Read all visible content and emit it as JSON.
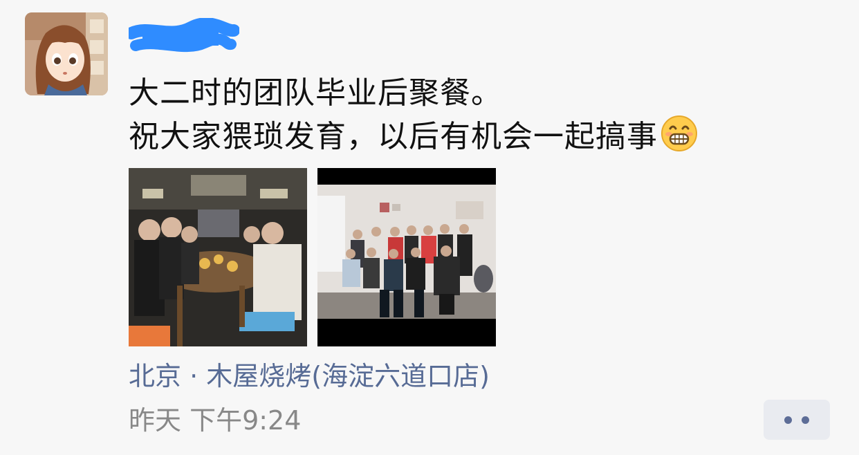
{
  "post": {
    "author_redacted": true,
    "text_lines": [
      "大二时的团队毕业后聚餐。",
      "祝大家猥琐发育，以后有机会一起搞事"
    ],
    "emoji": "grinning-face-emoji",
    "photos": [
      {
        "name": "restaurant-group-photo"
      },
      {
        "name": "office-group-photo"
      }
    ],
    "location": "北京 · 木屋烧烤(海淀六道口店)",
    "timestamp": "昨天 下午9:24"
  },
  "colors": {
    "link": "#576b95",
    "text": "#111111",
    "muted": "#888888",
    "redaction": "#2f8cff",
    "background": "#f7f7f7"
  },
  "icons": {
    "more": "more-dots-icon"
  }
}
